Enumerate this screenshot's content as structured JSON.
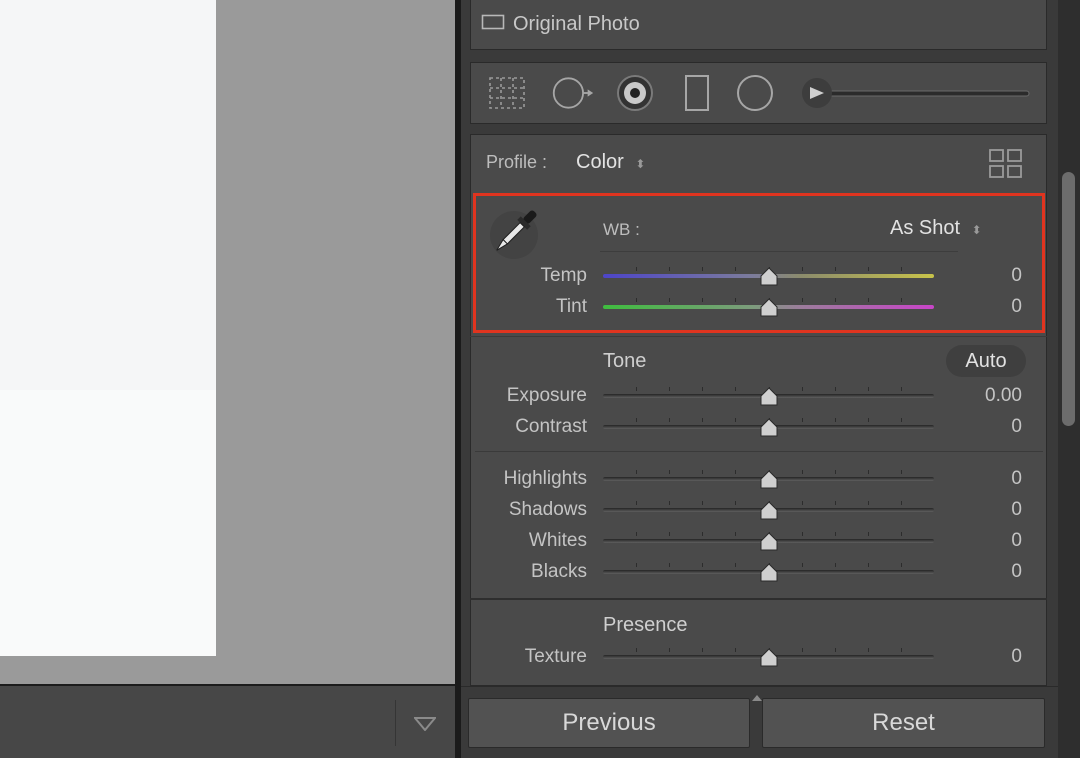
{
  "panel": {
    "original_photo_label": "Original Photo",
    "profile_label": "Profile :",
    "profile_value": "Color"
  },
  "white_balance": {
    "label": "WB :",
    "value": "As Shot",
    "temp": {
      "label": "Temp",
      "value": "0",
      "level": 0.5
    },
    "tint": {
      "label": "Tint",
      "value": "0",
      "level": 0.5
    }
  },
  "tone": {
    "title": "Tone",
    "auto_label": "Auto",
    "exposure": {
      "label": "Exposure",
      "value": "0.00",
      "level": 0.5
    },
    "contrast": {
      "label": "Contrast",
      "value": "0",
      "level": 0.5
    },
    "highlights": {
      "label": "Highlights",
      "value": "0",
      "level": 0.5
    },
    "shadows": {
      "label": "Shadows",
      "value": "0",
      "level": 0.5
    },
    "whites": {
      "label": "Whites",
      "value": "0",
      "level": 0.5
    },
    "blacks": {
      "label": "Blacks",
      "value": "0",
      "level": 0.5
    }
  },
  "presence": {
    "title": "Presence",
    "texture": {
      "label": "Texture",
      "value": "0",
      "level": 0.5
    }
  },
  "footer": {
    "previous_label": "Previous",
    "reset_label": "Reset"
  },
  "colors": {
    "highlight": "#e0341f",
    "panel": "#4a4a4a",
    "temp_left": "#4d45c8",
    "temp_right": "#c8c34a",
    "tint_left": "#3fbd3f",
    "tint_right": "#c845c8"
  },
  "icons": {
    "original": "photo-frame-icon",
    "grid": "grid-overlay-icon",
    "crop": "crop-circle-icon",
    "spot": "spot-removal-icon",
    "redeye": "red-eye-icon",
    "graduated": "graduated-filter-icon",
    "radial": "radial-filter-icon",
    "brush": "brush-size-slider",
    "profile_browser": "profile-browser-icon",
    "eyedropper": "eyedropper-icon",
    "filmstrip": "triangle-down-icon"
  }
}
